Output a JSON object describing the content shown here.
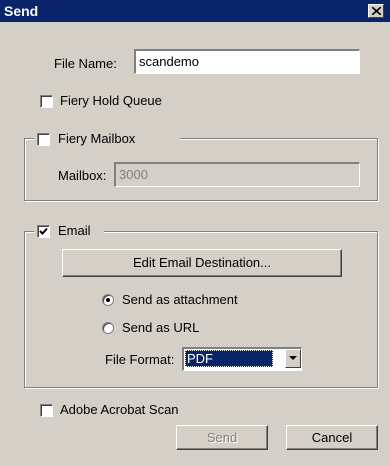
{
  "window": {
    "title": "Send",
    "close_glyph": "close-icon"
  },
  "file_name": {
    "label": "File Name:",
    "value": "scandemo"
  },
  "hold_queue": {
    "label": "Fiery Hold Queue",
    "checked": false
  },
  "mailbox_group": {
    "label": "Fiery Mailbox",
    "checked": false,
    "mailbox_label": "Mailbox:",
    "mailbox_value": "3000"
  },
  "email_group": {
    "label": "Email",
    "checked": true,
    "edit_button": "Edit Email Destination...",
    "radio_attachment": {
      "label": "Send as attachment",
      "selected": true
    },
    "radio_url": {
      "label": "Send as URL",
      "selected": false
    },
    "format_label": "File Format:",
    "format_value": "PDF"
  },
  "acrobat": {
    "label": "Adobe Acrobat Scan",
    "checked": false
  },
  "buttons": {
    "send": "Send",
    "cancel": "Cancel"
  }
}
